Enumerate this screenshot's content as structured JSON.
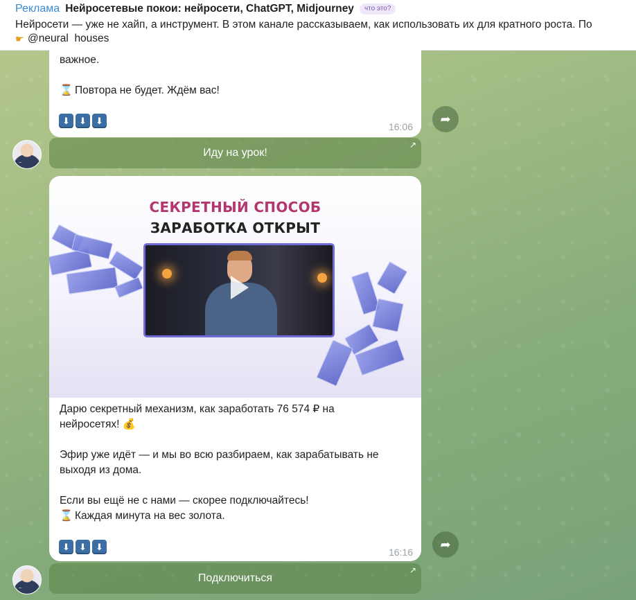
{
  "ad": {
    "label": "Реклама",
    "title": "Нейросетевые покои: нейросети, ChatGPT, Midjourney",
    "what_badge": "что это?",
    "description": "Нейросети — уже не хайп, а инструмент. В этом канале рассказываем, как использовать их для кратного роста. По",
    "handle": "@neural_houses",
    "handle_icon": "pointing-hand-icon"
  },
  "messages": [
    {
      "partial_line": "важное.",
      "line2": "Повтора не будет. Ждём вас!",
      "arrows": [
        "⬇",
        "⬇",
        "⬇"
      ],
      "time": "16:06",
      "button": "Иду на урок!"
    },
    {
      "image": {
        "headline1": "СЕКРЕТНЫЙ СПОСОБ",
        "headline2": "ЗАРАБОТКА ОТКРЫТ"
      },
      "para1a": "Дарю секретный механизм, как заработать 76 574 ₽ на",
      "para1b": "нейросетях!",
      "para2a": "Эфир уже идёт — и мы во всю разбираем, как зарабатывать не",
      "para2b": "выходя из дома.",
      "para3a": "Если вы ещё не с нами — скорее подключайтесь!",
      "para3b": "Каждая минута на вес золота.",
      "arrows": [
        "⬇",
        "⬇",
        "⬇"
      ],
      "time": "16:16",
      "button": "Подключиться"
    }
  ],
  "colors": {
    "ad_label": "#3a8bd6",
    "headline_accent": "#b2376e",
    "arrow_key": "#3a6ea5"
  }
}
